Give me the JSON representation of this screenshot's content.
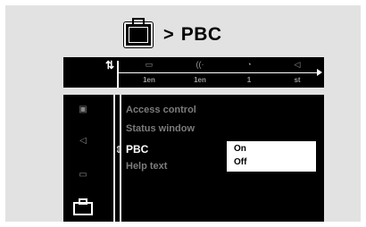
{
  "header": {
    "arrow": ">",
    "title": "PBC",
    "icon": "briefcase-icon"
  },
  "tabs": [
    {
      "name": "settings",
      "icon": "settings-icon",
      "glyph": "⇅",
      "value": ""
    },
    {
      "name": "subtitle",
      "icon": "subtitle-icon",
      "glyph": "▭",
      "value": "1en"
    },
    {
      "name": "audio",
      "icon": "audio-language-icon",
      "glyph": "((·",
      "value": "1en"
    },
    {
      "name": "angle",
      "icon": "angle-icon",
      "glyph": "◔",
      "value": "1"
    },
    {
      "name": "sound",
      "icon": "sound-mode-icon",
      "glyph": "◁",
      "value": "st"
    }
  ],
  "sidebar": {
    "items": [
      {
        "icon": "picture-icon",
        "glyph": "▣"
      },
      {
        "icon": "speaker-icon",
        "glyph": "◁"
      },
      {
        "icon": "language-icon",
        "glyph": "▭"
      },
      {
        "icon": "briefcase-icon",
        "glyph": "",
        "active": true
      }
    ]
  },
  "menu": {
    "items": [
      {
        "label": "Access control"
      },
      {
        "label": "Status window"
      },
      {
        "label": "PBC"
      },
      {
        "label": "Help text"
      }
    ],
    "selected_index": 2,
    "cursor_glyph": "⇕"
  },
  "submenu": {
    "options": [
      "On",
      "Off"
    ],
    "selected": "On",
    "cursor_glyph": "›"
  },
  "colors": {
    "background": "#e2e2e2",
    "panel": "#000000",
    "text_active": "#ffffff",
    "text_dim": "#7c7c7c"
  }
}
